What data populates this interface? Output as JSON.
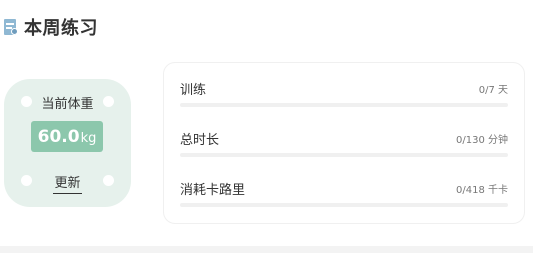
{
  "header": {
    "title": "本周练习",
    "icon": "report-icon"
  },
  "scale": {
    "label": "当前体重",
    "weight_value": "60.0",
    "weight_unit": "kg",
    "update_label": "更新"
  },
  "stats": [
    {
      "label": "训练",
      "value_text": "0/7 天",
      "progress": 0
    },
    {
      "label": "总时长",
      "value_text": "0/130 分钟",
      "progress": 0
    },
    {
      "label": "消耗卡路里",
      "value_text": "0/418 千卡",
      "progress": 0
    }
  ],
  "colors": {
    "accent": "#8cc7ac",
    "scale_bg": "#e6f1ec",
    "track": "#f0f0f0"
  }
}
